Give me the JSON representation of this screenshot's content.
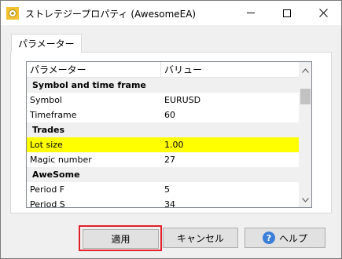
{
  "window": {
    "title": "ストレテジープロパティ (AwesomeEA)"
  },
  "tabs": [
    {
      "label": "パラメーター"
    }
  ],
  "grid": {
    "headers": [
      "パラメーター",
      "バリュー"
    ],
    "rows": [
      {
        "type": "group",
        "name": "Symbol and time frame",
        "value": ""
      },
      {
        "type": "param",
        "name": "Symbol",
        "value": "EURUSD"
      },
      {
        "type": "param",
        "name": "Timeframe",
        "value": "60"
      },
      {
        "type": "group",
        "name": "Trades",
        "value": ""
      },
      {
        "type": "param",
        "name": "Lot size",
        "value": "1.00",
        "selected": true
      },
      {
        "type": "param",
        "name": "Magic number",
        "value": "27"
      },
      {
        "type": "group",
        "name": "AweSome",
        "value": ""
      },
      {
        "type": "param",
        "name": "Period F",
        "value": "5"
      },
      {
        "type": "param",
        "name": "Period S",
        "value": "34"
      }
    ]
  },
  "buttons": {
    "apply": "適用",
    "cancel": "キャンセル",
    "help": "ヘルプ"
  },
  "colors": {
    "selected_row": "#ffff00",
    "group_row": "#f0f0f0",
    "apply_highlight": "#e0202a",
    "help_icon": "#3c7fd8"
  }
}
